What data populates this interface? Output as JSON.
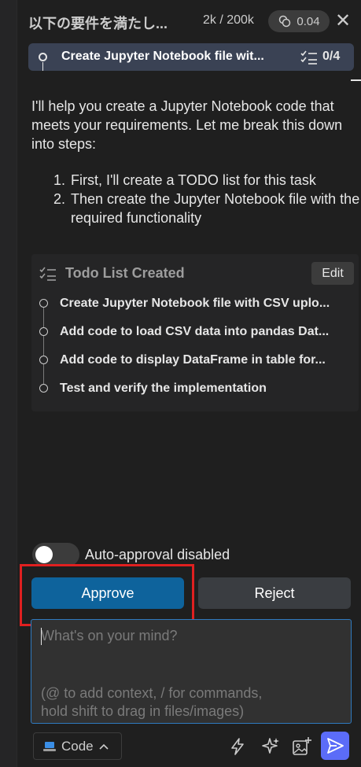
{
  "header": {
    "task_title": "以下の要件を満たし...",
    "tokens": "2k / 200k",
    "cost": "0.04",
    "close_icon": "close-icon"
  },
  "current_todo": {
    "label": "Create Jupyter Notebook file wit...",
    "count": "0/4"
  },
  "message": {
    "intro": "I'll help you create a Jupyter Notebook code that meets your requirements. Let me break this down into steps:",
    "steps": [
      {
        "num": "1.",
        "text": "First, I'll create a TODO list for this task"
      },
      {
        "num": "2.",
        "text": "Then create the Jupyter Notebook file with the required functionality"
      }
    ]
  },
  "todo_card": {
    "title": "Todo List Created",
    "edit_label": "Edit",
    "items": [
      "Create Jupyter Notebook file with CSV uplo...",
      "Add code to load CSV data into pandas Dat...",
      "Add code to display DataFrame in table for...",
      "Test and verify the implementation"
    ]
  },
  "auto_approval": {
    "label": "Auto-approval disabled",
    "enabled": false
  },
  "actions": {
    "approve_label": "Approve",
    "reject_label": "Reject"
  },
  "input": {
    "placeholder": "What's on your mind?",
    "hint_line1": "(@ to add context, / for commands,",
    "hint_line2": "hold shift to drag in files/images)"
  },
  "footer": {
    "mode_label": "Code",
    "icons": [
      "laptop-icon",
      "chevron-up-icon",
      "lightning-icon",
      "sparkle-icon",
      "add-image-icon",
      "send-icon"
    ]
  },
  "colors": {
    "accent": "#0e639c",
    "highlight_outline": "#e02020",
    "send": "#5b6cf8",
    "input_border": "#2f7ac0"
  }
}
